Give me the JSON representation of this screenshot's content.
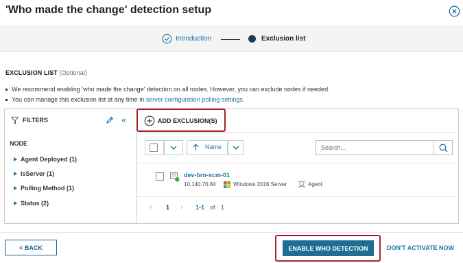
{
  "dialog": {
    "title": "'Who made the change' detection setup"
  },
  "stepper": {
    "steps": [
      {
        "label": "Introduction",
        "state": "done"
      },
      {
        "label": "Exclusion list",
        "state": "current"
      }
    ]
  },
  "exclusion": {
    "heading": "EXCLUSION LIST",
    "optional": "(Optional)",
    "bullet1": "We recommend enabling 'who made the change' detection on all nodes. However, you can exclude nodes if needed.",
    "bullet2_prefix": "You can manage this exclusion list at any time in ",
    "bullet2_link": "server configuration polling settings",
    "bullet2_suffix": "."
  },
  "filters": {
    "label": "FILTERS",
    "group": "NODE",
    "items": [
      {
        "label": "Agent Deployed (1)"
      },
      {
        "label": "IsServer (1)"
      },
      {
        "label": "Polling Method (1)"
      },
      {
        "label": "Status (2)"
      }
    ]
  },
  "toolbar": {
    "add_label": "ADD EXCLUSION(S)",
    "sort_label": "Name",
    "search_placeholder": "Search..."
  },
  "nodes": [
    {
      "name": "dev-brn-scm-01",
      "ip": "10.140.70.84",
      "os": "Windows 2016 Server",
      "polling": "Agent",
      "status": "up"
    }
  ],
  "pager": {
    "page": "1",
    "range": "1-1",
    "of": "of",
    "total": "1"
  },
  "footer": {
    "back_label": "< BACK",
    "enable_label": "ENABLE WHO DETECTION",
    "dont_label": "DON'T ACTIVATE NOW"
  },
  "colors": {
    "accent": "#1c73a6",
    "primary_button": "#1f6d93",
    "highlight": "#a81f2d",
    "status_up": "#3cb043"
  }
}
